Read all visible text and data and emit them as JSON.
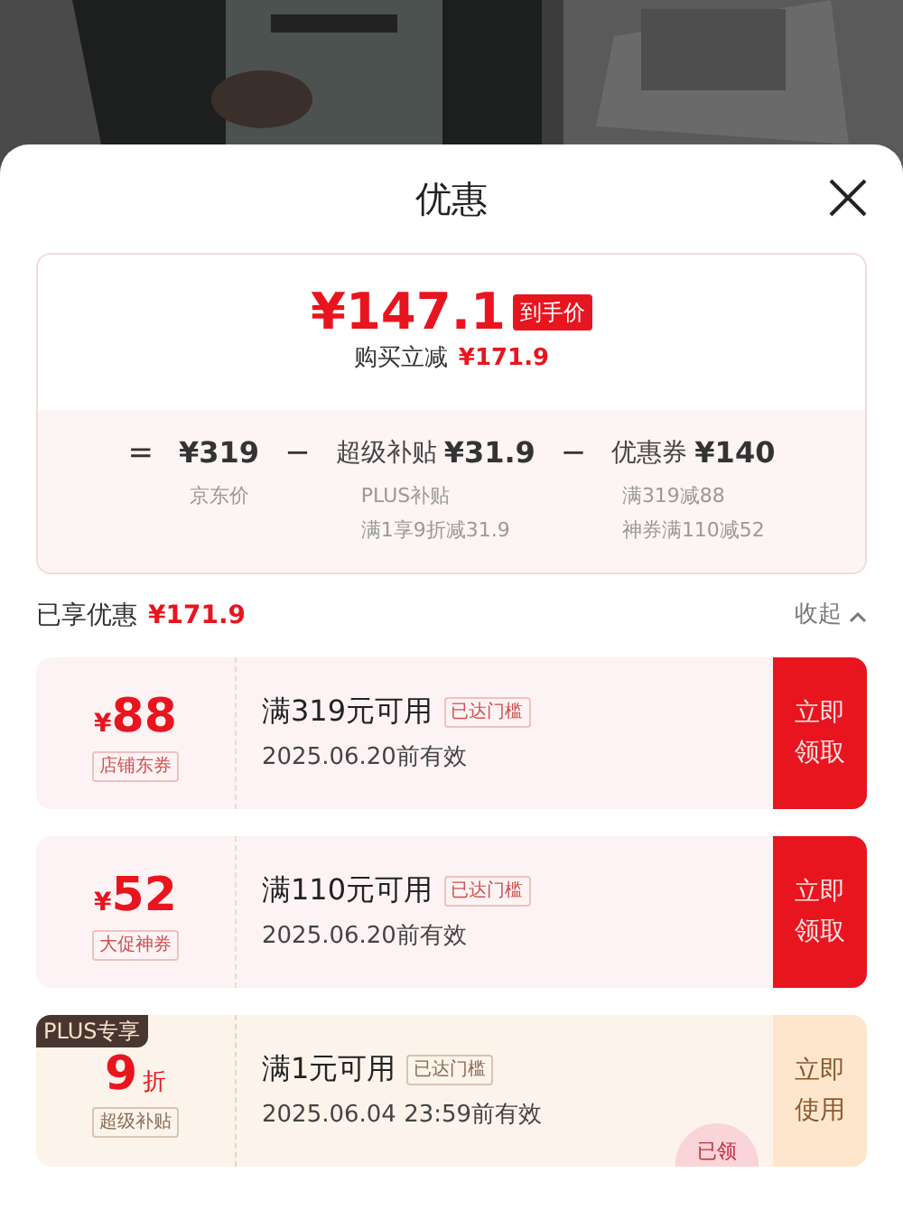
{
  "sheet": {
    "title": "优惠",
    "price_card": {
      "final_price": "¥147.1",
      "price_tag": "到手价",
      "discount_label": "购买立减",
      "discount_amount": "¥171.9",
      "breakdown": [
        {
          "kind": "operator",
          "text": "="
        },
        {
          "kind": "term",
          "value": "¥319",
          "notes": [
            "京东价"
          ]
        },
        {
          "kind": "operator",
          "text": "−"
        },
        {
          "kind": "term",
          "label": "超级补贴",
          "value": "¥31.9",
          "notes": [
            "PLUS补贴",
            "满1享9折减31.9"
          ]
        },
        {
          "kind": "operator",
          "text": "−"
        },
        {
          "kind": "term",
          "label": "优惠券",
          "value": "¥140",
          "notes": [
            "满319减88",
            "神券满110减52"
          ]
        }
      ]
    },
    "summary": {
      "label": "已享优惠",
      "amount": "¥171.9",
      "toggle": "收起"
    },
    "coupons": [
      {
        "kind": "coupon",
        "currency": "¥",
        "amount": "88",
        "tag": "店铺东券",
        "condition": "满319元可用",
        "status": "已达门槛",
        "validity": "2025.06.20前有效",
        "action": "立即领取"
      },
      {
        "kind": "coupon",
        "currency": "¥",
        "amount": "52",
        "tag": "大促神券",
        "condition": "满110元可用",
        "status": "已达门槛",
        "validity": "2025.06.20前有效",
        "action": "立即领取"
      },
      {
        "kind": "plus",
        "badge": "PLUS专享",
        "amount": "9",
        "unit": "折",
        "tag": "超级补贴",
        "condition": "满1元可用",
        "status": "已达门槛",
        "validity": "2025.06.04 23:59前有效",
        "action": "立即使用",
        "stamp": "已领"
      }
    ]
  }
}
